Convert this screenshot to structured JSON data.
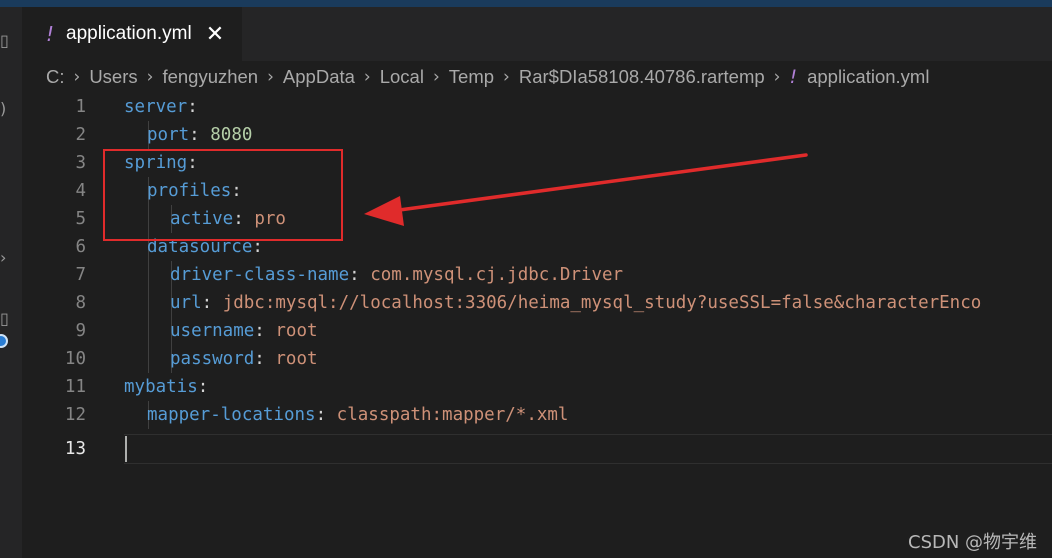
{
  "tab": {
    "icon": "!",
    "title": "application.yml",
    "close": "✕"
  },
  "breadcrumb": [
    "C:",
    "Users",
    "fengyuzhen",
    "AppData",
    "Local",
    "Temp",
    "Rar$DIa58108.40786.rartemp"
  ],
  "breadcrumb_file_icon": "!",
  "breadcrumb_file": "application.yml",
  "breadcrumb_sep": "›",
  "editor": {
    "active_line": 13,
    "lines": [
      {
        "num": "1",
        "key": "server",
        "colon": ":",
        "value": ""
      },
      {
        "num": "2",
        "key": "port",
        "colon": ":",
        "value": "8080"
      },
      {
        "num": "3",
        "key": "spring",
        "colon": ":",
        "value": ""
      },
      {
        "num": "4",
        "key": "profiles",
        "colon": ":",
        "value": ""
      },
      {
        "num": "5",
        "key": "active",
        "colon": ":",
        "value": "pro"
      },
      {
        "num": "6",
        "key": "datasource",
        "colon": ":",
        "value": ""
      },
      {
        "num": "7",
        "key": "driver-class-name",
        "colon": ":",
        "value": "com.mysql.cj.jdbc.Driver"
      },
      {
        "num": "8",
        "key": "url",
        "colon": ":",
        "value": "jdbc:mysql://localhost:3306/heima_mysql_study?useSSL=false&characterEnco"
      },
      {
        "num": "9",
        "key": "username",
        "colon": ":",
        "value": "root"
      },
      {
        "num": "10",
        "key": "password",
        "colon": ":",
        "value": "root"
      },
      {
        "num": "11",
        "key": "mybatis",
        "colon": ":",
        "value": ""
      },
      {
        "num": "12",
        "key": "mapper-locations",
        "colon": ":",
        "value": "classpath:mapper/*.xml"
      },
      {
        "num": "13",
        "key": "",
        "colon": "",
        "value": ""
      }
    ]
  },
  "activity_icons": [
    "files-icon",
    "search-icon",
    "source-control-icon",
    "extensions-icon"
  ],
  "annotation": {
    "color": "#e02b2b"
  },
  "watermark": "CSDN @物宇维"
}
